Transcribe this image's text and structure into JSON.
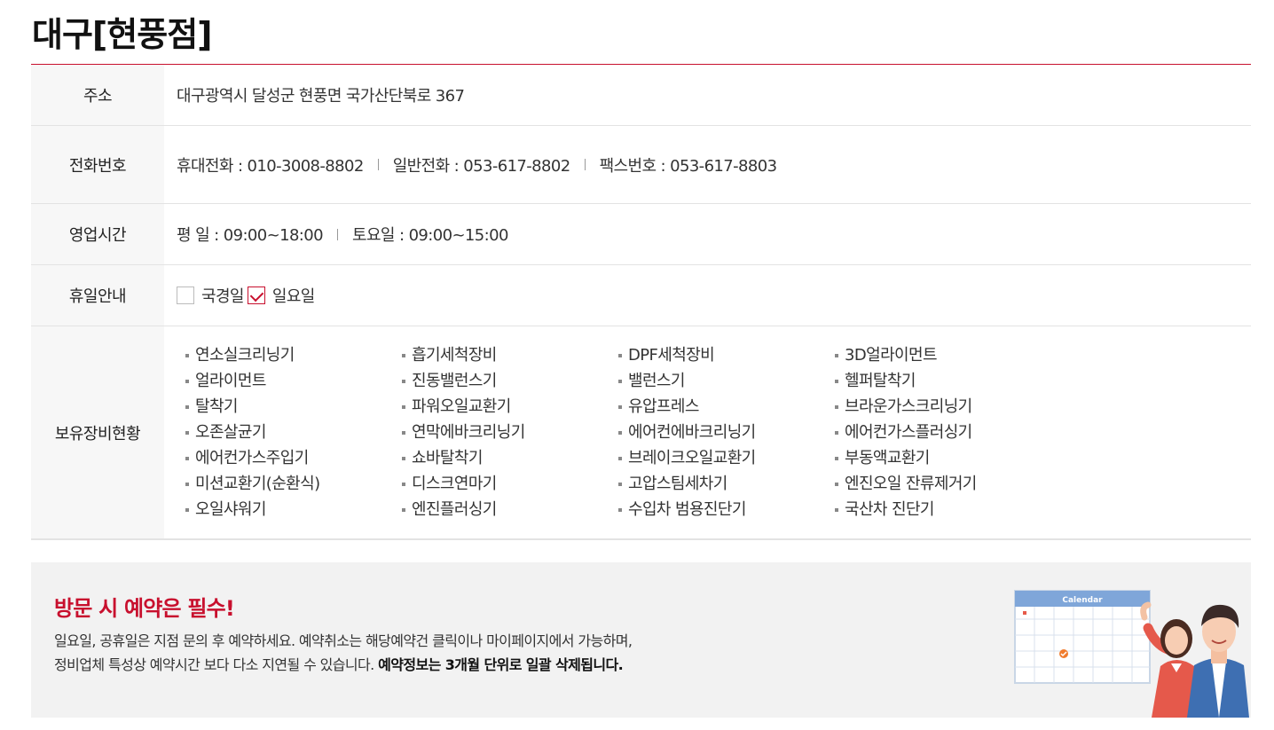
{
  "page": {
    "title": "대구[현풍점]"
  },
  "info": {
    "address": {
      "label": "주소",
      "value": "대구광역시 달성군 현풍면 국가산단북로 367"
    },
    "phone": {
      "label": "전화번호",
      "mobile": "휴대전화 : 010-3008-8802",
      "landline": "일반전화 : 053-617-8802",
      "fax": "팩스번호 : 053-617-8803"
    },
    "hours": {
      "label": "영업시간",
      "weekday": "평 일 : 09:00~18:00",
      "saturday": "토요일 : 09:00~15:00"
    },
    "holiday": {
      "label": "휴일안내",
      "options": [
        {
          "label": "국경일",
          "checked": false
        },
        {
          "label": "일요일",
          "checked": true
        }
      ]
    },
    "equipment": {
      "label": "보유장비현황",
      "items": [
        "연소실크리닝기",
        "흡기세척장비",
        "DPF세척장비",
        "3D얼라이먼트",
        "얼라이먼트",
        "진동밸런스기",
        "밸런스기",
        "헬퍼탈착기",
        "탈착기",
        "파워오일교환기",
        "유압프레스",
        "브라운가스크리닝기",
        "오존살균기",
        "연막에바크리닝기",
        "에어컨에바크리닝기",
        "에어컨가스플러싱기",
        "에어컨가스주입기",
        "쇼바탈착기",
        "브레이크오일교환기",
        "부동액교환기",
        "미션교환기(순환식)",
        "디스크연마기",
        "고압스팀세차기",
        "엔진오일 잔류제거기",
        "오일샤워기",
        "엔진플러싱기",
        "수입차 범용진단기",
        "국산차 진단기"
      ]
    }
  },
  "notice": {
    "title": "방문 시 예약은 필수!",
    "line1": "일요일, 공휴일은 지점 문의 후 예약하세요. 예약취소는 해당예약건 클릭이나 마이페이지에서 가능하며,",
    "line2_normal": "정비업체 특성상 예약시간 보다 다소 지연될 수 있습니다. ",
    "line2_bold": "예약정보는 3개월 단위로 일괄 삭제됩니다."
  },
  "illustration": {
    "calendar_label": "Calendar"
  },
  "colors": {
    "accent": "#c8102e",
    "table_header_bg": "#f7f7f7",
    "notice_bg": "#f2f2f2"
  }
}
